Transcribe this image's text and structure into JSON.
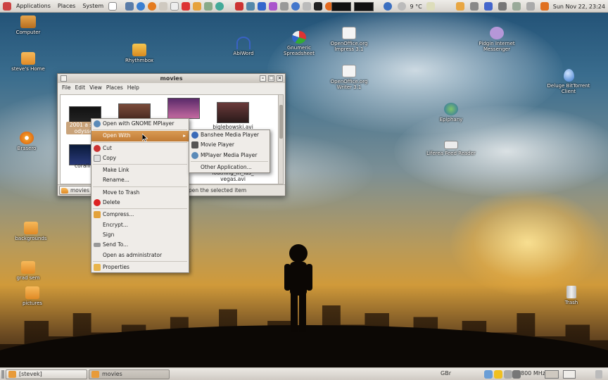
{
  "top_panel": {
    "menus": [
      "Applications",
      "Places",
      "System"
    ],
    "weather": "9 °C",
    "clock": "Sun Nov 22, 23:24"
  },
  "desktop_icons": [
    {
      "label": "Computer"
    },
    {
      "label": "steve's Home"
    },
    {
      "label": "Rhythmbox"
    },
    {
      "label": "AbiWord"
    },
    {
      "label": "Gnumeric Spreadsheet"
    },
    {
      "label": "OpenOffice.org Impress 3.1"
    },
    {
      "label": "OpenOffice.org Writer 3.1"
    },
    {
      "label": "Pidgin Internet Messenger"
    },
    {
      "label": "Deluge BitTorrent Client"
    },
    {
      "label": "Brasero"
    },
    {
      "label": "Epiphany"
    },
    {
      "label": "Liferea Feed Reader"
    },
    {
      "label": "backgrounds"
    },
    {
      "label": "grad sem"
    },
    {
      "label": "pictures"
    },
    {
      "label": "Trash"
    }
  ],
  "window": {
    "title": "movies",
    "menus": [
      "File",
      "Edit",
      "View",
      "Places",
      "Help"
    ],
    "files": [
      {
        "label": "2001 a sp... odyssey"
      },
      {
        "label": ""
      },
      {
        "label": ""
      },
      {
        "label": "biglebowski.avi"
      },
      {
        "label": "coraline"
      },
      {
        "label": "loathing_in_las_ vegas.avi"
      }
    ],
    "path_button": "movies",
    "status": "pen the selected item"
  },
  "context_menu": {
    "items": [
      {
        "label": "Open with GNOME MPlayer"
      },
      {
        "label": "Open With"
      },
      {
        "label": "Cut"
      },
      {
        "label": "Copy"
      },
      {
        "label": "Make Link"
      },
      {
        "label": "Rename..."
      },
      {
        "label": "Move to Trash"
      },
      {
        "label": "Delete"
      },
      {
        "label": "Compress..."
      },
      {
        "label": "Encrypt..."
      },
      {
        "label": "Sign"
      },
      {
        "label": "Send To..."
      },
      {
        "label": "Open as administrator"
      },
      {
        "label": "Properties"
      }
    ]
  },
  "submenu": {
    "items": [
      {
        "label": "Banshee Media Player"
      },
      {
        "label": "Movie Player"
      },
      {
        "label": "MPlayer Media Player"
      },
      {
        "label": "Other Application..."
      }
    ]
  },
  "bottom_panel": {
    "tasks": [
      "[stevek]",
      "movies"
    ],
    "keyboard": "GBr",
    "cpu_freq": "800 MHz"
  }
}
